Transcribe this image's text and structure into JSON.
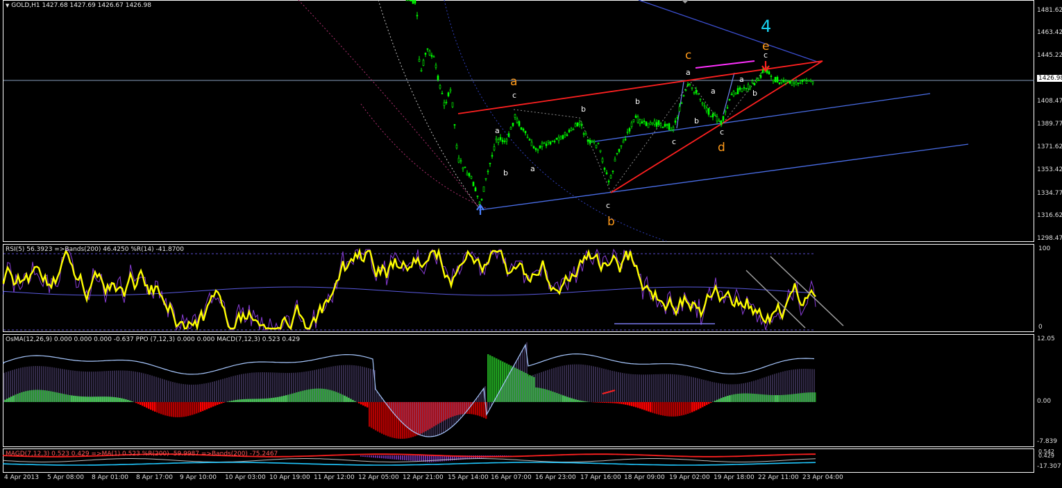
{
  "window": {
    "title": "GOLD,H1  1427.68 1427.69 1426.67 1426.98",
    "current_price": "1426.98"
  },
  "colors": {
    "background": "#000000",
    "grid_border": "#ffffff",
    "candle_bull": "#00ff00",
    "trend_red": "#ff2020",
    "channel_blue": "#4a6ee8",
    "rsi_yellow": "#ffff00",
    "osma_green": "#33cc33",
    "osma_red": "#ff0000",
    "macd_purple": "#9c86e0"
  },
  "main_pane": {
    "price_axis": [
      "1481.62",
      "1463.42",
      "1445.22",
      "1426.98",
      "1408.47",
      "1389.77",
      "1371.62",
      "1353.42",
      "1334.77",
      "1316.62",
      "1298.47"
    ],
    "wave_labels": [
      {
        "text": "4",
        "color": "#19d3f2",
        "size": "large"
      },
      {
        "text": "a",
        "color": "#ff9a1a",
        "size": "mid"
      },
      {
        "text": "b",
        "color": "#ff9a1a",
        "size": "mid"
      },
      {
        "text": "c",
        "color": "#ff9a1a",
        "size": "mid"
      },
      {
        "text": "d",
        "color": "#ff9a1a",
        "size": "mid"
      },
      {
        "text": "e",
        "color": "#ff9a1a",
        "size": "mid"
      }
    ],
    "sub_labels": [
      "c",
      "a",
      "b",
      "a",
      "b",
      "c",
      "b",
      "c",
      "a",
      "b",
      "a",
      "c",
      "a",
      "b",
      "c"
    ]
  },
  "rsi_pane": {
    "title": "RSI(5) 56.3923  =>Bands(200) 46.4250  %R(14) -41.8700",
    "axis": [
      "100",
      "0"
    ]
  },
  "osma_pane": {
    "title": "OsMA(12,26,9) 0.000 0.000 0.000 -0.637  PPO (7,12,3) 0.000 0.000  MACD(7,12,3) 0.523 0.429",
    "axis": [
      "12.05",
      "0.00",
      "-7.839"
    ]
  },
  "magd_pane": {
    "title": "MAGD(7,12,3) 0.523 0.429  =>MA(1) 0.523  %R(200) -59.9987  =>Bands(200) -75.2467",
    "axis": [
      "0.542",
      "0.429",
      "-17.307"
    ]
  },
  "time_axis": [
    "4 Apr 2013",
    "5 Apr 08:00",
    "8 Apr 01:00",
    "8 Apr 17:00",
    "9 Apr 10:00",
    "10 Apr 03:00",
    "10 Apr 19:00",
    "11 Apr 12:00",
    "12 Apr 05:00",
    "12 Apr 21:00",
    "15 Apr 14:00",
    "16 Apr 07:00",
    "16 Apr 23:00",
    "17 Apr 16:00",
    "18 Apr 09:00",
    "19 Apr 02:00",
    "19 Apr 18:00",
    "22 Apr 11:00",
    "23 Apr 04:00"
  ]
}
